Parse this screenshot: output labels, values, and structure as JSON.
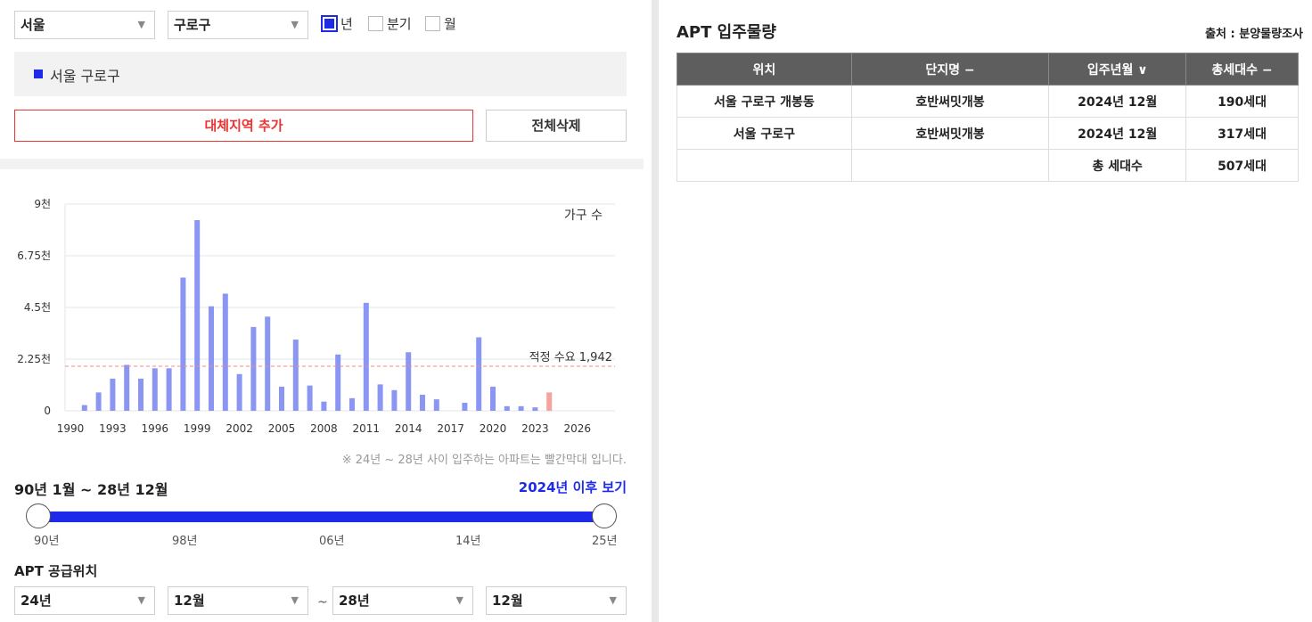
{
  "filters": {
    "city": "서울",
    "district": "구로구",
    "period_options": [
      {
        "label": "년",
        "checked": true
      },
      {
        "label": "분기",
        "checked": false
      },
      {
        "label": "월",
        "checked": false
      }
    ]
  },
  "selected_region": "서울 구로구",
  "buttons": {
    "add_region": "대체지역 추가",
    "delete_all": "전체삭제"
  },
  "colors": {
    "accent": "#1d2be8",
    "bar": "#8a96f2",
    "bar_future": "#f4a49c",
    "demand_line": "#f28b82",
    "alert": "#ee3333"
  },
  "chart_data": {
    "type": "bar",
    "legend": "가구 수",
    "y_ticks": [
      "0",
      "2.25천",
      "4.5천",
      "6.75천",
      "9천"
    ],
    "ylim": [
      0,
      9000
    ],
    "x_ticks": [
      "1990",
      "1993",
      "1996",
      "1999",
      "2002",
      "2005",
      "2008",
      "2011",
      "2014",
      "2017",
      "2020",
      "2023",
      "2026"
    ],
    "x": [
      1991,
      1992,
      1993,
      1994,
      1995,
      1996,
      1997,
      1998,
      1999,
      2000,
      2001,
      2002,
      2003,
      2004,
      2005,
      2006,
      2007,
      2008,
      2009,
      2010,
      2011,
      2012,
      2013,
      2014,
      2015,
      2016,
      2018,
      2019,
      2020,
      2021,
      2022,
      2023,
      2024
    ],
    "values": [
      250,
      800,
      1400,
      2000,
      1400,
      1850,
      1850,
      5800,
      8300,
      4550,
      5100,
      1600,
      3650,
      4100,
      1050,
      3100,
      1100,
      400,
      2450,
      550,
      4700,
      1150,
      900,
      2550,
      700,
      500,
      350,
      3200,
      1050,
      200,
      200,
      150,
      800
    ],
    "future_from": 2024,
    "reference_line": {
      "value": 1942,
      "label": "적정 수요 1,942"
    }
  },
  "chart_note": "※ 24년 ~ 28년 사이 입주하는 아파트는 빨간막대 입니다.",
  "range": {
    "label": "90년 1월 ~ 28년 12월",
    "after_link": "2024년 이후 보기",
    "ticks": [
      "90년",
      "98년",
      "06년",
      "14년",
      "25년"
    ]
  },
  "supply": {
    "title": "APT 공급위치",
    "from_year": "24년",
    "from_month": "12월",
    "separator": "~",
    "to_year": "28년",
    "to_month": "12월"
  },
  "table": {
    "title": "APT 입주물량",
    "source": "출처 : 분양물량조사",
    "headers": [
      "위치",
      "단지명 −",
      "입주년월 ∨",
      "총세대수 −"
    ],
    "rows": [
      [
        "서울 구로구 개봉동",
        "호반써밋개봉",
        "2024년 12월",
        "190세대"
      ],
      [
        "서울 구로구",
        "호반써밋개봉",
        "2024년 12월",
        "317세대"
      ],
      [
        "",
        "",
        "총 세대수",
        "507세대"
      ]
    ]
  }
}
